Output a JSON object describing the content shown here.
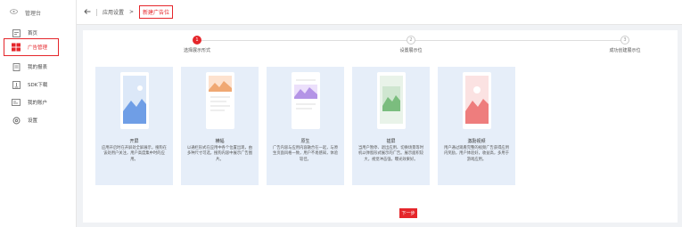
{
  "sidebar": {
    "header_label": "管理台",
    "items": [
      {
        "label": "首页",
        "icon": "home-icon"
      },
      {
        "label": "广告管理",
        "icon": "grid-icon",
        "active": true
      },
      {
        "label": "我的报表",
        "icon": "report-icon"
      },
      {
        "label": "SDK下载",
        "icon": "download-icon"
      },
      {
        "label": "我的账户",
        "icon": "account-icon"
      },
      {
        "label": "设置",
        "icon": "gear-icon"
      }
    ]
  },
  "topbar": {
    "breadcrumb_home": "应用设置",
    "breadcrumb_sep": ">",
    "breadcrumb_current": "新建广告位"
  },
  "stepper": [
    {
      "number": "1",
      "label": "选择展示形式",
      "state": "done"
    },
    {
      "number": "2",
      "label": "设置展示位",
      "state": "todo"
    },
    {
      "number": "3",
      "label": "成功创建展示位",
      "state": "todo"
    }
  ],
  "cards": [
    {
      "name": "开屏",
      "desc": "应用开启时在开屏处全屏展示，搜狗在该处用户关注，用户高度集中时的应用。",
      "accent": "#6f9ee6",
      "card_bg": "#e6eef9"
    },
    {
      "name": "横幅",
      "desc": "以通栏形式在应用中各个位置出现，由多种尺寸可选，搜狗内容中展示广告图片。",
      "accent": "#f0a873",
      "card_bg": "#e6eef9"
    },
    {
      "name": "原生",
      "desc": "广告内容与应用内容融合在一起，与原生页面风格一致，用户不易感知，体验较佳。",
      "accent": "#b494e6",
      "card_bg": "#e6eef9"
    },
    {
      "name": "插屏",
      "desc": "当用户暂停、退出应用、切换场景等时机以弹窗形式展示的广告。展示面积较大，视觉冲击强，曝光效果好。",
      "accent": "#7bbd7e",
      "card_bg": "#e6eef9"
    },
    {
      "name": "激励视频",
      "desc": "用户通过观看完整的视频广告获得应用内奖励，用户体验好，收益高，多用于游戏应用。",
      "accent": "#ee7d7d",
      "card_bg": "#e6eef9"
    }
  ],
  "next_button": "下一步",
  "colors": {
    "brand": "#e5262b"
  }
}
